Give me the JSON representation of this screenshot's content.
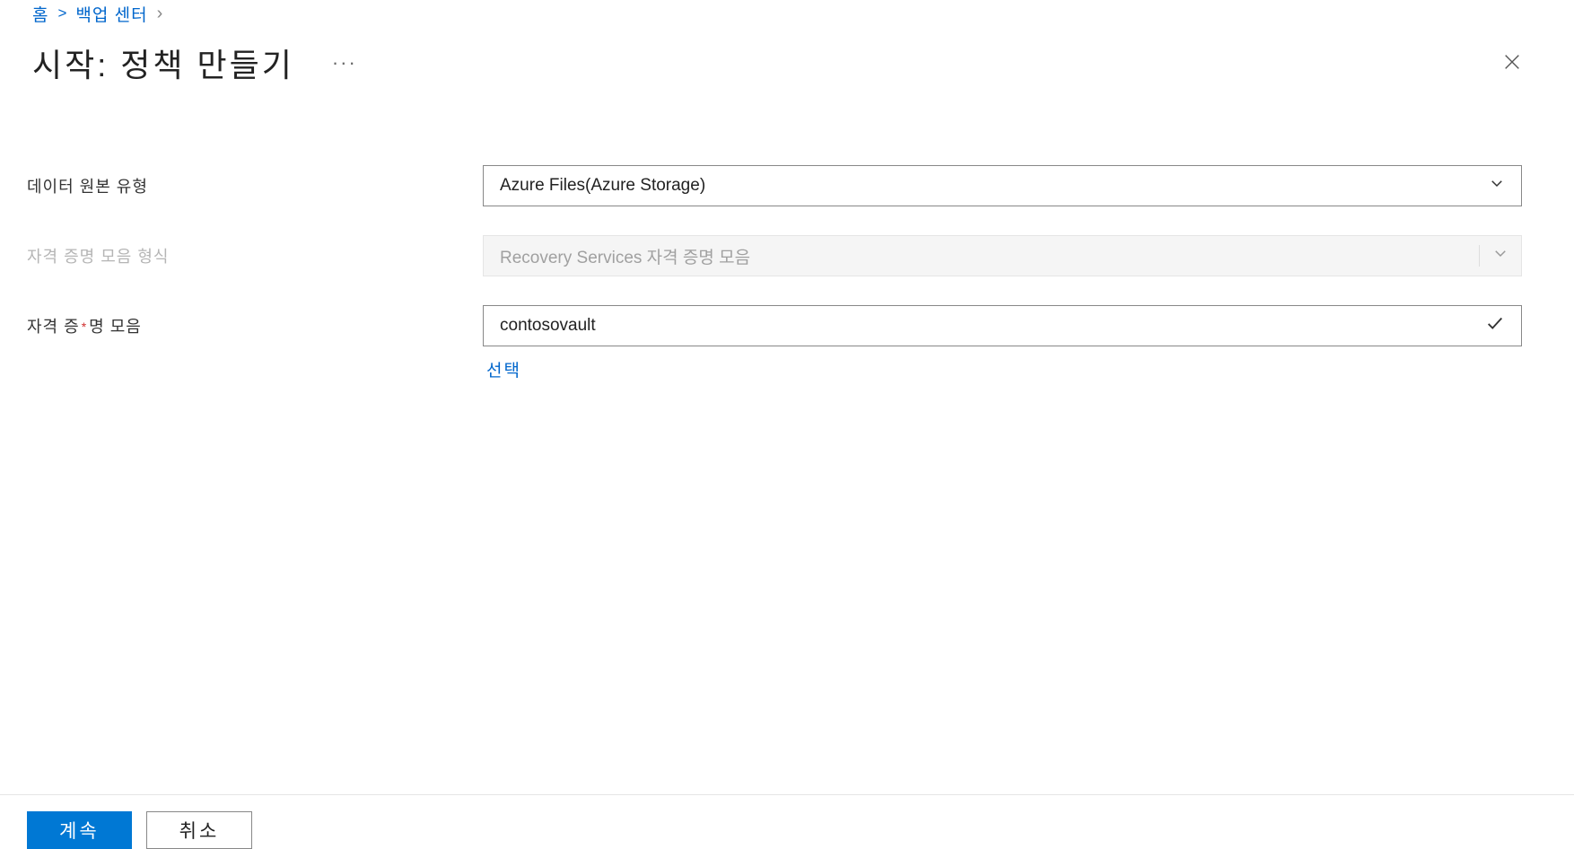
{
  "breadcrumb": {
    "home": "홈",
    "backup_center": "백업 센터"
  },
  "page_title": "시작: 정책 만들기",
  "ellipsis": "···",
  "form": {
    "datasource_type": {
      "label": "데이터 원본 유형",
      "value": "Azure Files(Azure Storage)"
    },
    "vault_type": {
      "label": "자격 증명 모음 형식",
      "value": "Recovery Services 자격 증명 모음"
    },
    "vault": {
      "label_pre": "자격 증",
      "label_post": "명 모음",
      "value": "contosovault",
      "select_link": "선택"
    }
  },
  "footer": {
    "continue": "계속",
    "cancel": "취소"
  }
}
